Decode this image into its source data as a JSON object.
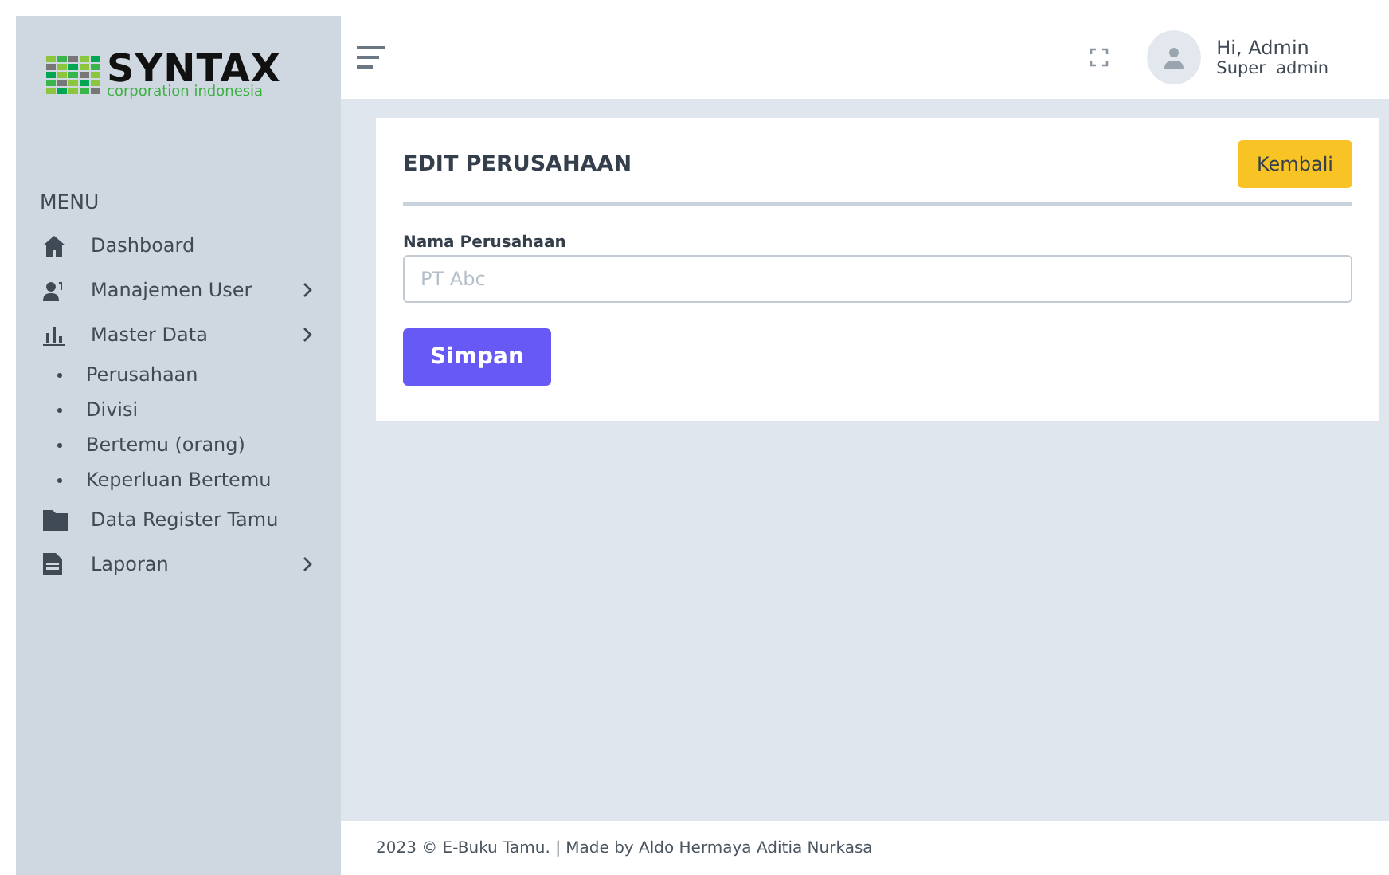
{
  "logo": {
    "name": "SYNTAX",
    "tagline": "corporation indonesia"
  },
  "sidebar": {
    "heading": "MENU",
    "items": [
      {
        "label": "Dashboard",
        "kind": "home",
        "expandable": false
      },
      {
        "label": "Manajemen User",
        "kind": "users",
        "expandable": true
      },
      {
        "label": "Master Data",
        "kind": "chart",
        "expandable": true,
        "children": [
          {
            "label": "Perusahaan"
          },
          {
            "label": "Divisi"
          },
          {
            "label": "Bertemu (orang)"
          },
          {
            "label": "Keperluan Bertemu"
          }
        ]
      },
      {
        "label": "Data Register Tamu",
        "kind": "folder",
        "expandable": false
      },
      {
        "label": "Laporan",
        "kind": "file",
        "expandable": true
      }
    ]
  },
  "user": {
    "greeting": "Hi, Admin",
    "role": "Super  admin"
  },
  "card": {
    "title": "EDIT PERUSAHAAN",
    "back_button": "Kembali",
    "field_label": "Nama Perusahaan",
    "placeholder": "PT Abc",
    "submit_button": "Simpan"
  },
  "footer": "2023 © E-Buku Tamu. | Made by Aldo Hermaya Aditia Nurkasa"
}
